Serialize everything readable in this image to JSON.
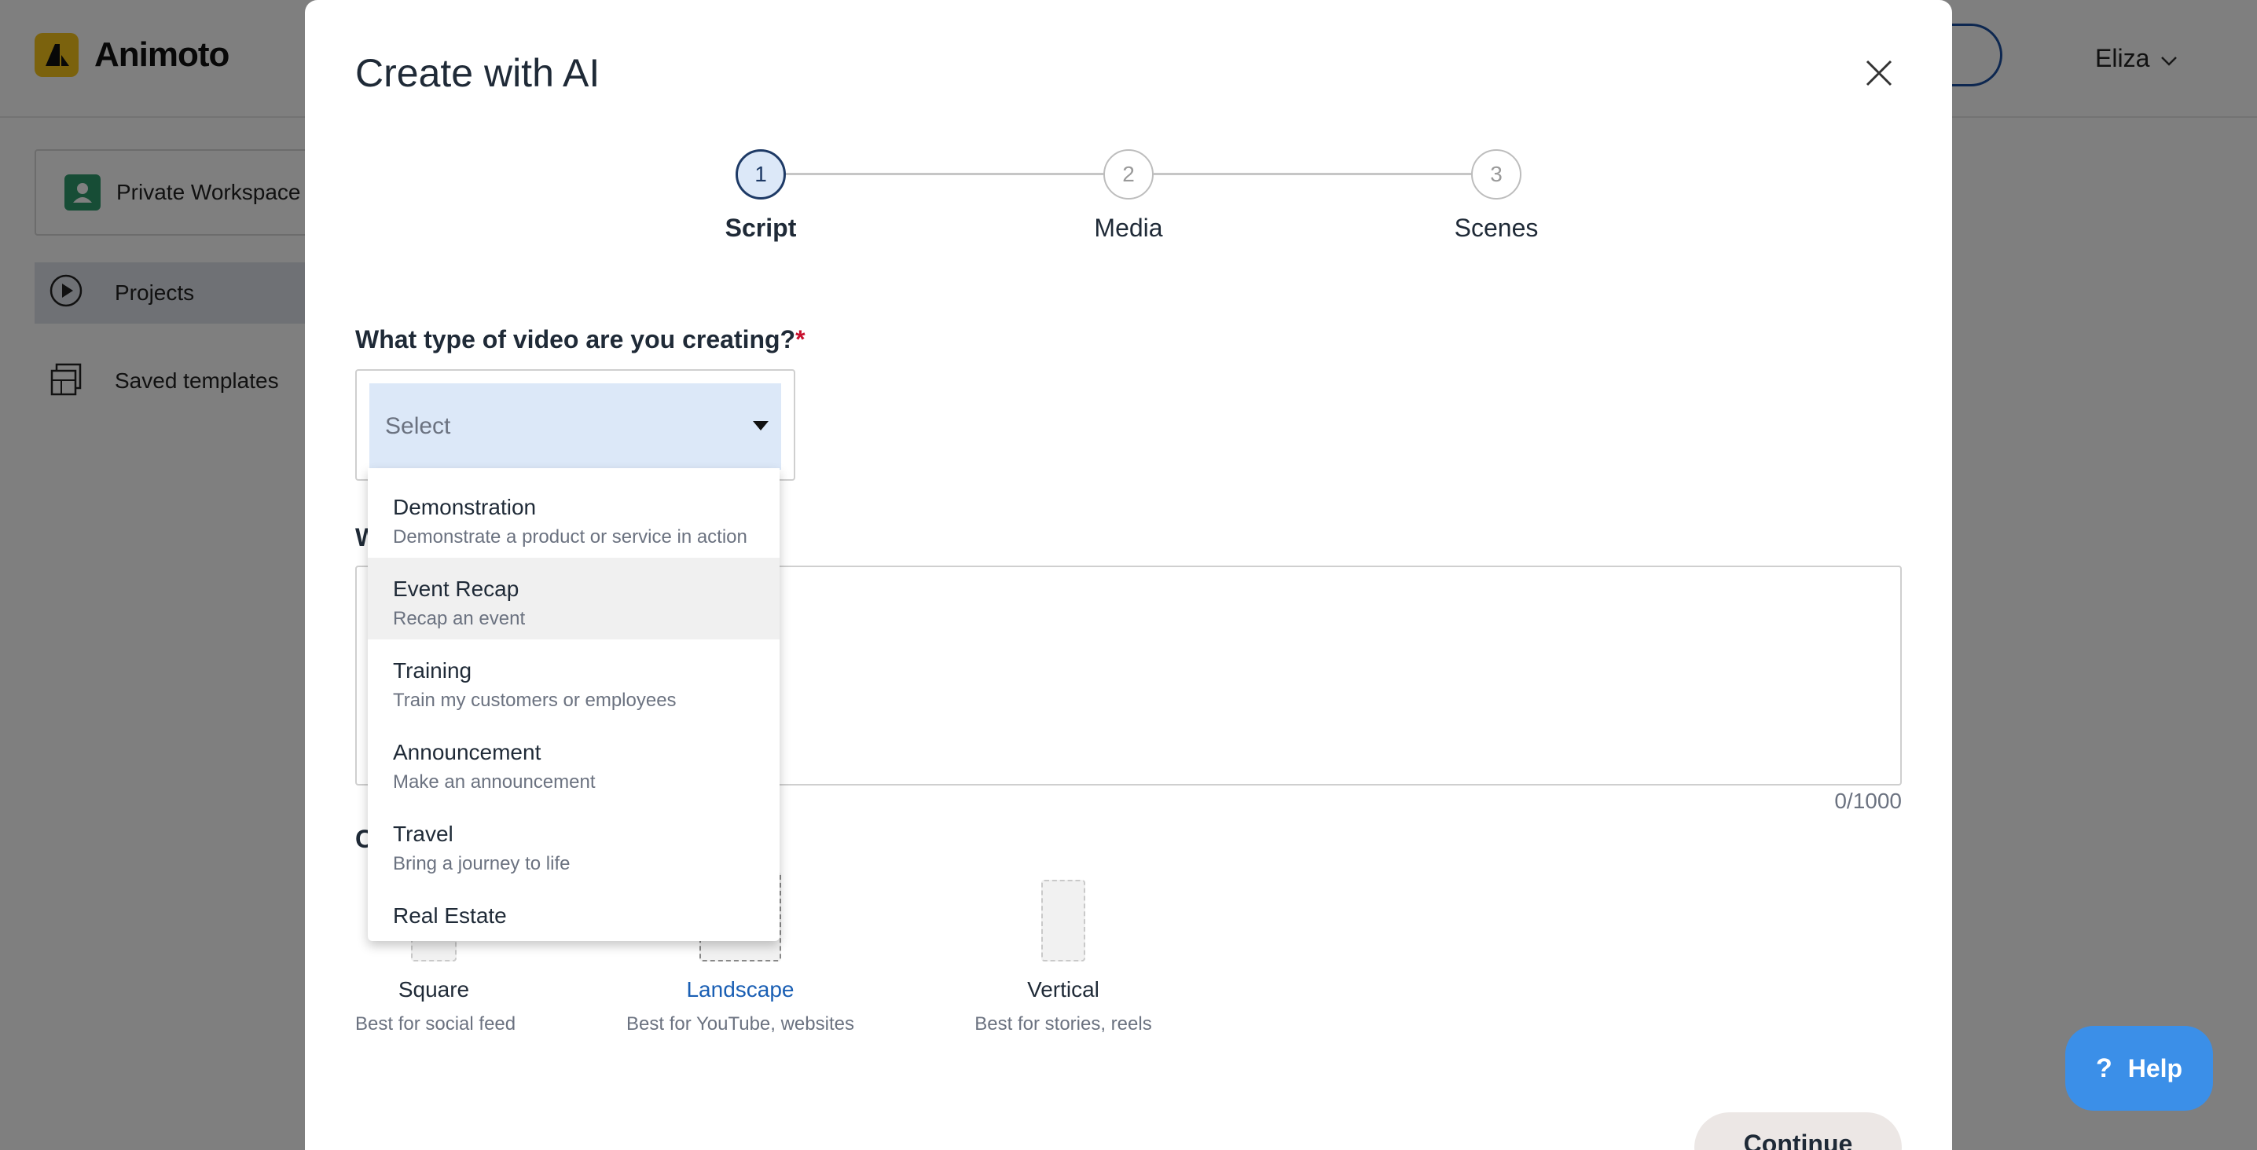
{
  "app": {
    "name": "Animoto",
    "user_name": "Eliza"
  },
  "sidebar": {
    "workspace_label": "Private Workspace",
    "items": [
      {
        "label": "Projects",
        "icon": "play-circle-icon"
      },
      {
        "label": "Saved templates",
        "icon": "templates-icon"
      }
    ]
  },
  "modal": {
    "title": "Create with AI",
    "steps": [
      {
        "number": "1",
        "label": "Script",
        "active": true
      },
      {
        "number": "2",
        "label": "Media",
        "active": false
      },
      {
        "number": "3",
        "label": "Scenes",
        "active": false
      }
    ],
    "video_type": {
      "label": "What type of video are you creating?",
      "required_mark": "*",
      "placeholder": "Select"
    },
    "second_label_partial": "W",
    "char_count": "0/1000",
    "third_label_partial": "C",
    "aspects": [
      {
        "name": "Square",
        "desc": "Best for social feed",
        "selected": false
      },
      {
        "name": "Landscape",
        "desc": "Best for YouTube, websites",
        "selected": true
      },
      {
        "name": "Vertical",
        "desc": "Best for stories, reels",
        "selected": false
      }
    ],
    "continue_label": "Continue"
  },
  "dropdown": {
    "options": [
      {
        "title": "Demonstration",
        "desc": "Demonstrate a product or service in action"
      },
      {
        "title": "Event Recap",
        "desc": "Recap an event"
      },
      {
        "title": "Training",
        "desc": "Train my customers or employees"
      },
      {
        "title": "Announcement",
        "desc": "Make an announcement"
      },
      {
        "title": "Travel",
        "desc": "Bring a journey to life"
      },
      {
        "title": "Real Estate",
        "desc": ""
      }
    ]
  },
  "help": {
    "label": "Help",
    "icon_text": "?"
  },
  "colors": {
    "accent": "#1a5fb4",
    "help_blue": "#3b8fe8",
    "select_bg": "#dce8f8",
    "required": "#c8102e",
    "brand_yellow": "#f6c51b"
  }
}
